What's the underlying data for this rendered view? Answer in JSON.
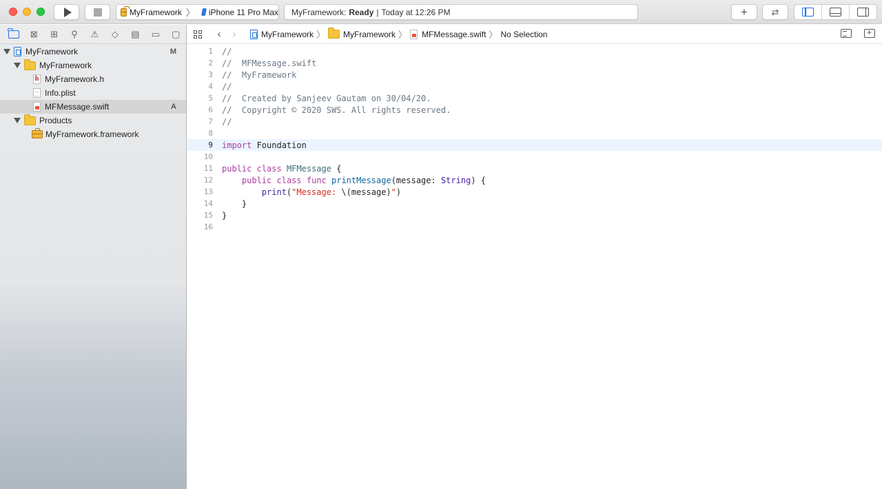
{
  "toolbar": {
    "scheme_name": "MyFramework",
    "device_name": "iPhone 11 Pro Max",
    "status_project": "MyFramework:",
    "status_state": "Ready",
    "status_separator": "|",
    "status_time": "Today at 12:26 PM",
    "add_label": "+",
    "swap_label": "⇄"
  },
  "navigator": {
    "tree": [
      {
        "label": "MyFramework",
        "badge": "M"
      },
      {
        "label": "MyFramework",
        "badge": ""
      },
      {
        "label": "MyFramework.h",
        "badge": ""
      },
      {
        "label": "Info.plist",
        "badge": ""
      },
      {
        "label": "MFMessage.swift",
        "badge": "A"
      },
      {
        "label": "Products",
        "badge": ""
      },
      {
        "label": "MyFramework.framework",
        "badge": ""
      }
    ]
  },
  "jumpbar": {
    "project": "MyFramework",
    "group": "MyFramework",
    "file": "MFMessage.swift",
    "selection": "No Selection"
  },
  "editor": {
    "current_line": 9,
    "lines": [
      {
        "n": "1",
        "parts": [
          {
            "t": "//",
            "c": "c"
          }
        ]
      },
      {
        "n": "2",
        "parts": [
          {
            "t": "//  MFMessage.swift",
            "c": "c"
          }
        ]
      },
      {
        "n": "3",
        "parts": [
          {
            "t": "//  MyFramework",
            "c": "c"
          }
        ]
      },
      {
        "n": "4",
        "parts": [
          {
            "t": "//",
            "c": "c"
          }
        ]
      },
      {
        "n": "5",
        "parts": [
          {
            "t": "//  Created by Sanjeev Gautam on 30/04/20.",
            "c": "c"
          }
        ]
      },
      {
        "n": "6",
        "parts": [
          {
            "t": "//  Copyright © 2020 SWS. All rights reserved.",
            "c": "c"
          }
        ]
      },
      {
        "n": "7",
        "parts": [
          {
            "t": "//",
            "c": "c"
          }
        ]
      },
      {
        "n": "8",
        "parts": []
      },
      {
        "n": "9",
        "parts": [
          {
            "t": "import",
            "c": "k"
          },
          {
            "t": " Foundation",
            "c": "p"
          }
        ]
      },
      {
        "n": "10",
        "parts": []
      },
      {
        "n": "11",
        "parts": [
          {
            "t": "public",
            "c": "k"
          },
          {
            "t": " ",
            "c": "p"
          },
          {
            "t": "class",
            "c": "k"
          },
          {
            "t": " ",
            "c": "p"
          },
          {
            "t": "MFMessage",
            "c": "t"
          },
          {
            "t": " {",
            "c": "p"
          }
        ]
      },
      {
        "n": "12",
        "parts": [
          {
            "t": "    ",
            "c": "p"
          },
          {
            "t": "public",
            "c": "k"
          },
          {
            "t": " ",
            "c": "p"
          },
          {
            "t": "class",
            "c": "k"
          },
          {
            "t": " ",
            "c": "p"
          },
          {
            "t": "func",
            "c": "k"
          },
          {
            "t": " ",
            "c": "p"
          },
          {
            "t": "printMessage",
            "c": "fn"
          },
          {
            "t": "(message: ",
            "c": "p"
          },
          {
            "t": "String",
            "c": "f"
          },
          {
            "t": ") {",
            "c": "p"
          }
        ]
      },
      {
        "n": "13",
        "parts": [
          {
            "t": "        ",
            "c": "p"
          },
          {
            "t": "print",
            "c": "f"
          },
          {
            "t": "(",
            "c": "p"
          },
          {
            "t": "\"Message: ",
            "c": "s"
          },
          {
            "t": "\\(message)",
            "c": "p"
          },
          {
            "t": "\"",
            "c": "s"
          },
          {
            "t": ")",
            "c": "p"
          }
        ]
      },
      {
        "n": "14",
        "parts": [
          {
            "t": "    }",
            "c": "p"
          }
        ]
      },
      {
        "n": "15",
        "parts": [
          {
            "t": "}",
            "c": "p"
          }
        ]
      },
      {
        "n": "16",
        "parts": []
      }
    ]
  }
}
